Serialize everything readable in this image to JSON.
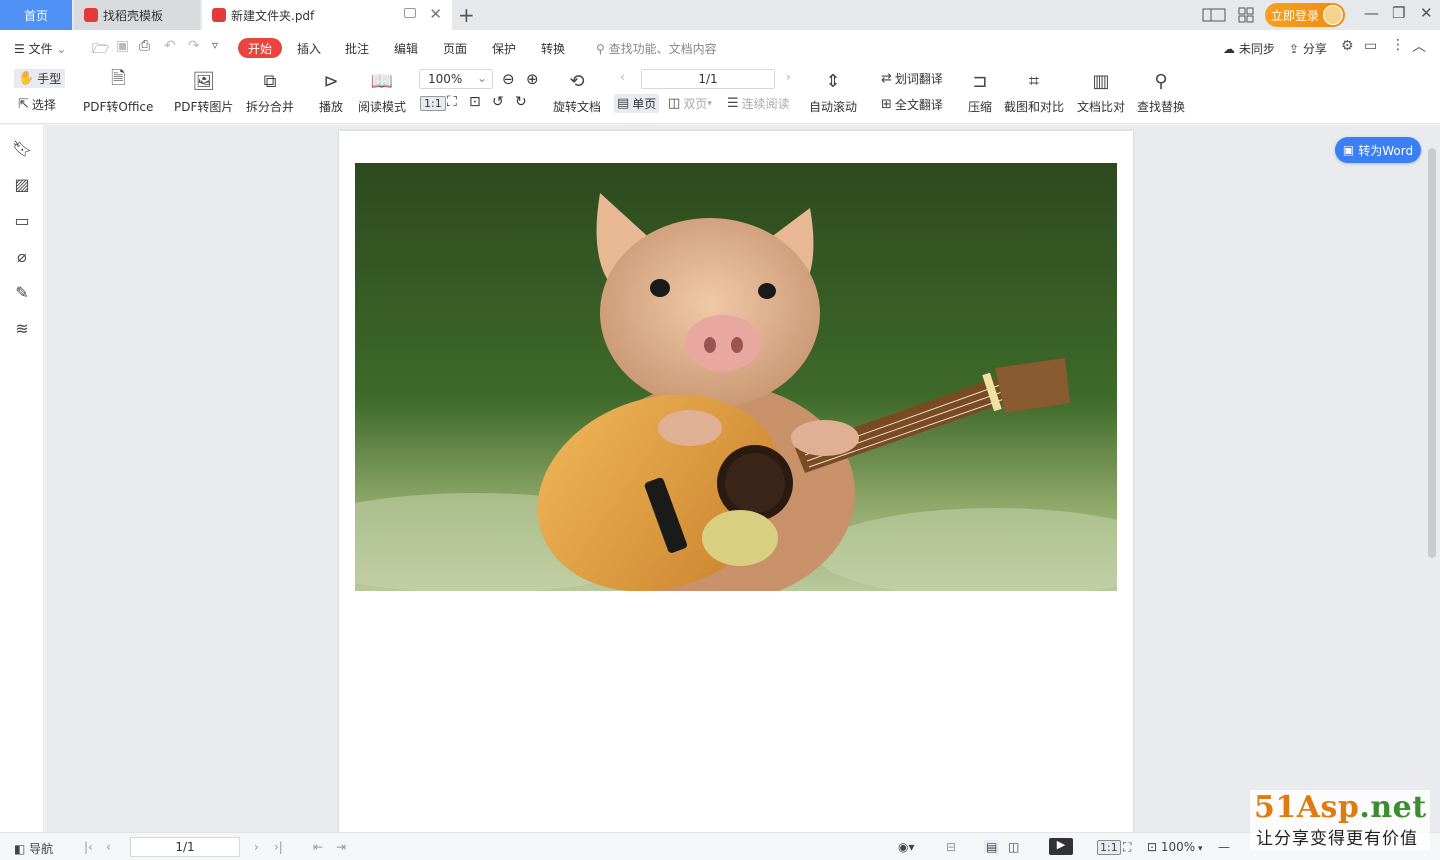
{
  "tabs": {
    "home": "首页",
    "templates": "找稻壳模板",
    "document": "新建文件夹.pdf",
    "new_tab_icon": "+"
  },
  "titlebar": {
    "login": "立即登录",
    "window_controls": [
      "minimize",
      "restore",
      "close"
    ]
  },
  "menubar": {
    "file": "文件",
    "start": "开始",
    "items": [
      "插入",
      "批注",
      "编辑",
      "页面",
      "保护",
      "转换"
    ],
    "search_placeholder": "查找功能、文档内容",
    "sync": "未同步",
    "share": "分享"
  },
  "ribbon": {
    "hand": "手型",
    "select": "选择",
    "pdf_to_office": "PDF转Office",
    "pdf_to_image": "PDF转图片",
    "split_merge": "拆分合并",
    "play": "播放",
    "read_mode": "阅读模式",
    "zoom": "100%",
    "rotate_doc": "旋转文档",
    "single_page": "单页",
    "double_page": "双页",
    "continuous": "连续阅读",
    "page_indicator": "1/1",
    "auto_scroll": "自动滚动",
    "word_translate": "划词翻译",
    "full_translate": "全文翻译",
    "compress": "压缩",
    "screenshot_compare": "截图和对比",
    "doc_compare": "文档比对",
    "find_replace": "查找替换"
  },
  "canvas": {
    "to_word": "转为Word"
  },
  "statusbar": {
    "nav": "导航",
    "page": "1/1",
    "zoom": "100%"
  },
  "watermark": {
    "site_part1": "51Asp",
    "site_part2": ".net",
    "slogan": "让分享变得更有价值"
  }
}
